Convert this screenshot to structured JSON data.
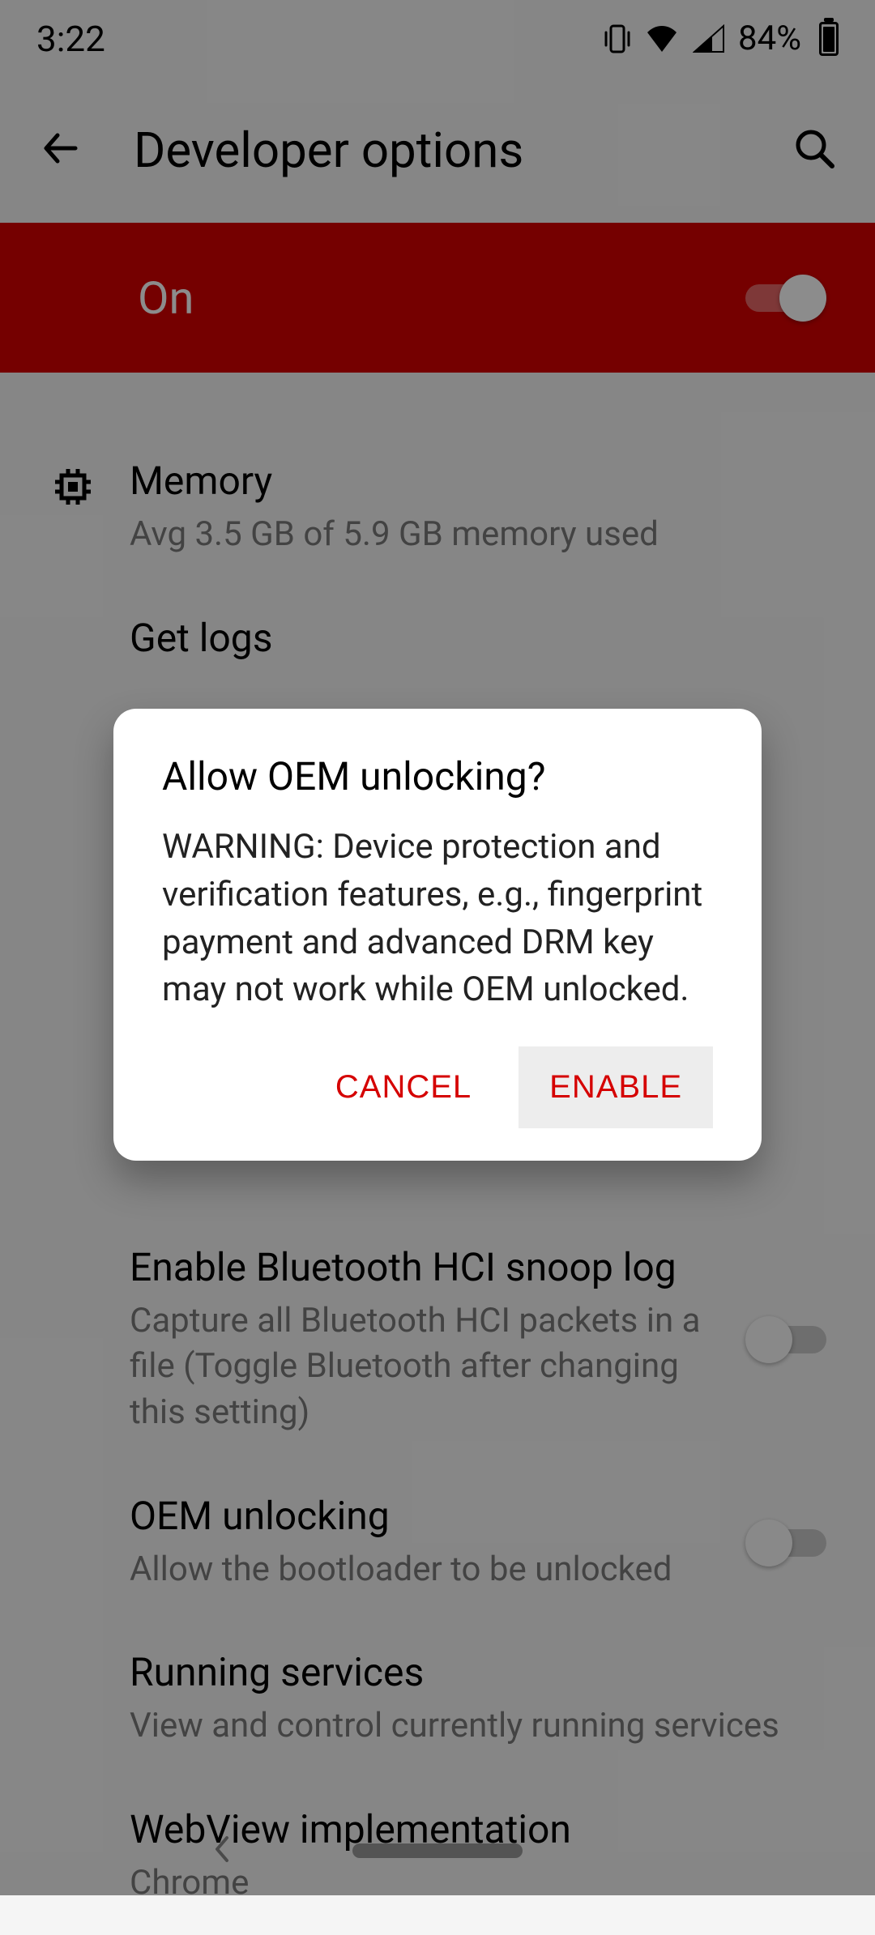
{
  "status": {
    "time": "3:22",
    "battery_pct": "84%"
  },
  "header": {
    "title": "Developer options"
  },
  "master_toggle": {
    "label": "On"
  },
  "rows": {
    "memory": {
      "title": "Memory",
      "sub": "Avg 3.5 GB of 5.9 GB memory used"
    },
    "get_logs": {
      "title": "Get logs"
    },
    "hci": {
      "title": "Enable Bluetooth HCI snoop log",
      "sub": "Capture all Bluetooth HCI packets in a file (Toggle Bluetooth after changing this setting)"
    },
    "oem": {
      "title": "OEM unlocking",
      "sub": "Allow the bootloader to be unlocked"
    },
    "running": {
      "title": "Running services",
      "sub": "View and control currently running services"
    },
    "webview": {
      "title": "WebView implementation",
      "sub": "Chrome"
    }
  },
  "dialog": {
    "title": "Allow OEM unlocking?",
    "body": "WARNING: Device protection and verification features, e.g., fingerprint payment and advanced DRM key may not work while OEM unlocked.",
    "cancel": "CANCEL",
    "enable": "ENABLE"
  }
}
